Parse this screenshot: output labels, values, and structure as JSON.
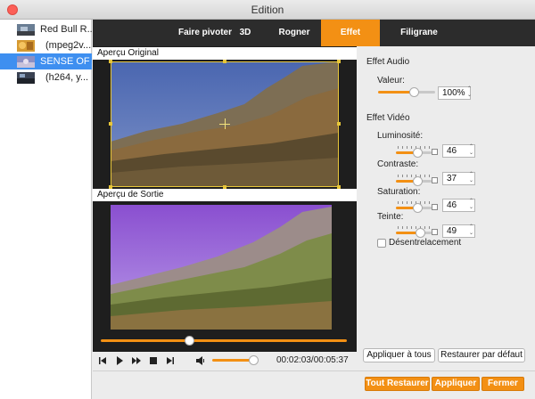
{
  "window": {
    "title": "Edition"
  },
  "sidebar": {
    "items": [
      {
        "label": "Red Bull R...",
        "selected": false
      },
      {
        "label": "(mpeg2v...",
        "selected": false
      },
      {
        "label": "SENSE OF ...",
        "selected": true
      },
      {
        "label": "(h264, y...",
        "selected": false
      }
    ]
  },
  "tabs": [
    {
      "label": "Faire pivoter",
      "active": false
    },
    {
      "label": "3D",
      "active": false
    },
    {
      "label": "Rogner",
      "active": false
    },
    {
      "label": "Effet",
      "active": true
    },
    {
      "label": "Filigrane",
      "active": false
    }
  ],
  "preview": {
    "original_label": "Aperçu Original",
    "output_label": "Aperçu de Sortie",
    "time": "00:02:03/00:05:37",
    "playback_progress": 0.36,
    "volume_level": 0.85
  },
  "audio": {
    "title": "Effet Audio",
    "value_label": "Valeur:",
    "value": "100%",
    "level": 0.5
  },
  "video": {
    "title": "Effet Vidéo",
    "brightness_label": "Luminosité:",
    "brightness": "46",
    "contrast_label": "Contraste:",
    "contrast": "37",
    "saturation_label": "Saturation:",
    "saturation": "46",
    "hue_label": "Teinte:",
    "hue": "49",
    "deinterlace_label": "Désentrelacement",
    "deinterlace_checked": false
  },
  "buttons": {
    "apply_all": "Appliquer à tous",
    "restore_default": "Restaurer par défaut",
    "restore_all": "Tout Restaurer",
    "apply": "Appliquer",
    "close": "Fermer"
  },
  "colors": {
    "accent": "#f39014",
    "selection": "#3e8ff0",
    "tabbar": "#2c2c2c"
  }
}
